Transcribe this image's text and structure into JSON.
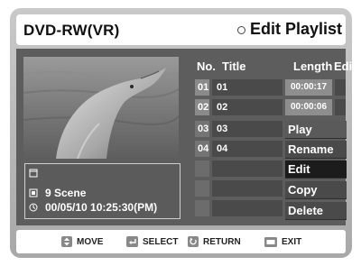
{
  "header": {
    "device_label": "DVD-RW(VR)",
    "screen_title": "Edit Playlist"
  },
  "list": {
    "columns": {
      "no": "No.",
      "title": "Title",
      "length": "Length",
      "edit": "Edit"
    },
    "rows": [
      {
        "no": "01",
        "title": "01",
        "length": "00:00:17"
      },
      {
        "no": "02",
        "title": "02",
        "length": "00:00:06"
      },
      {
        "no": "03",
        "title": "03",
        "length": ""
      },
      {
        "no": "04",
        "title": "04",
        "length": ""
      }
    ]
  },
  "menu": {
    "items": [
      "Play",
      "Rename",
      "Edit Scene",
      "Copy",
      "Delete"
    ],
    "selected": "Edit Scene"
  },
  "info": {
    "scene_count": "9 Scene",
    "datetime": "00/05/10   10:25:30(PM)"
  },
  "footer": {
    "move_label": "MOVE",
    "select_label": "SELECT",
    "return_label": "RETURN",
    "exit_label": "EXIT"
  }
}
